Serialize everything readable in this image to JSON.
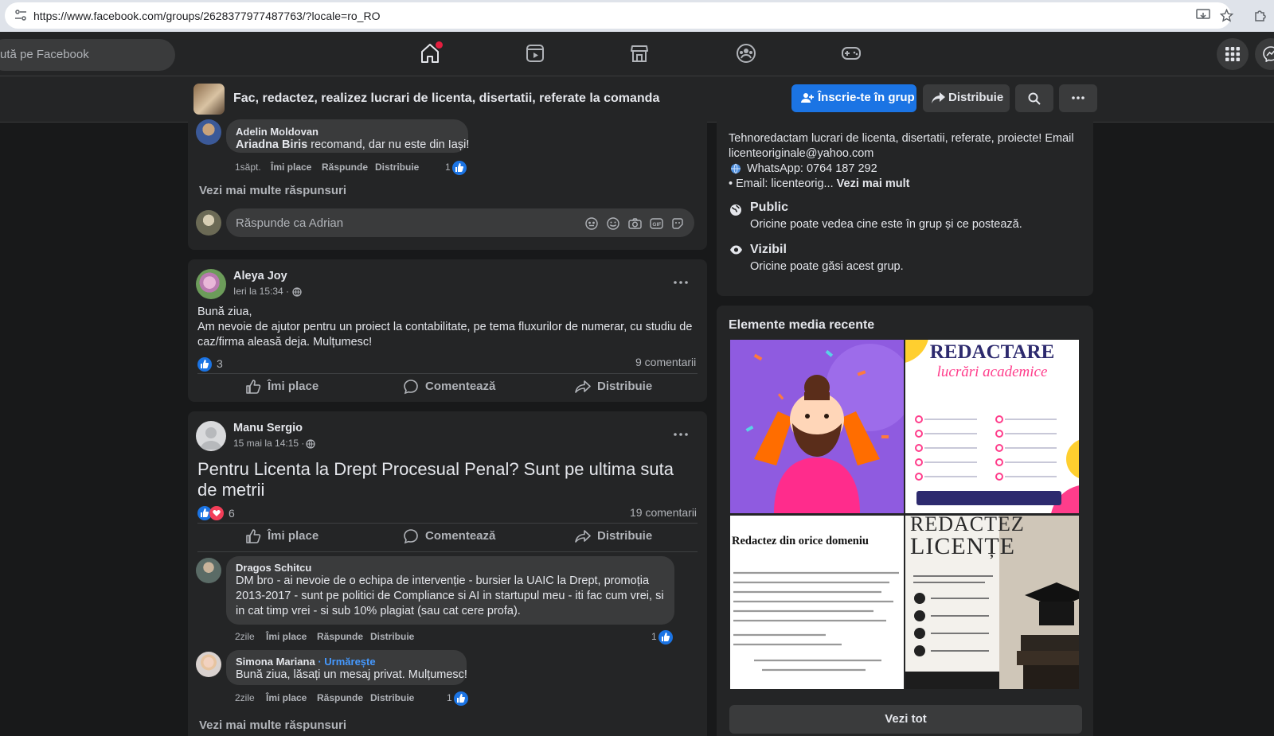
{
  "browser": {
    "url": "https://www.facebook.com/groups/2628377977487763/?locale=ro_RO"
  },
  "nav": {
    "search_placeholder": "ută pe Facebook",
    "icons": [
      "home-icon",
      "video-icon",
      "marketplace-icon",
      "groups-icon",
      "gaming-icon",
      "menu-grid-icon",
      "messenger-icon"
    ],
    "notification_color": "#e41e3f"
  },
  "group": {
    "title": "Fac, redactez, realizez lucrari de licenta, disertatii, referate la comanda",
    "join_label": "Înscrie-te în grup",
    "share_label": "Distribuie",
    "accent": "#1b74e4"
  },
  "comment_top": {
    "author": "Adelin Moldovan",
    "mention": "Ariadna Biris",
    "text": " recomand, dar nu este din Iași!",
    "time": "1săpt.",
    "like": "Îmi place",
    "reply": "Răspunde",
    "share": "Distribuie",
    "reactions": "1"
  },
  "more_replies_1": "Vezi mai multe răspunsuri",
  "reply_box": {
    "placeholder": "Răspunde ca Adrian",
    "icons": [
      "avatar-sticker-icon",
      "emoji-icon",
      "camera-icon",
      "gif-icon",
      "sticker-icon"
    ]
  },
  "post1": {
    "author": "Aleya Joy",
    "time": "Ieri la 15:34 ·",
    "text_lines": [
      "Bună ziua,",
      "Am nevoie de ajutor pentru un proiect la contabilitate, pe tema fluxurilor de numerar, cu studiu de",
      "caz/firma aleasă deja. Mulțumesc!"
    ],
    "reactions": "3",
    "comments": "9 comentarii",
    "like": "Îmi place",
    "comment": "Comentează",
    "share": "Distribuie"
  },
  "post2": {
    "author": "Manu Sergio",
    "time": "15 mai la 14:15 ·",
    "title_lines": [
      "Pentru Licenta la Drept Procesual Penal? Sunt pe ultima suta",
      "de metrii"
    ],
    "reactions": "6",
    "comments": "19 comentarii",
    "like": "Îmi place",
    "comment": "Comentează",
    "share": "Distribuie",
    "comments_list": [
      {
        "author": "Dragos Schitcu",
        "lines": [
          "DM bro - ai nevoie de o echipa de intervenție - bursier la UAIC la Drept, promoția",
          "2013-2017 - sunt pe politici de Compliance si AI in startupul meu - iti fac cum vrei, si",
          "in cat timp vrei - si sub 10% plagiat (sau cat cere profa)."
        ],
        "time": "2zile",
        "like": "Îmi place",
        "reply": "Răspunde",
        "share": "Distribuie",
        "reactions": "1"
      },
      {
        "author": "Simona Mariana",
        "follow": "· Urmărește",
        "lines": [
          "Bună ziua, lăsați un mesaj privat. Mulțumesc!"
        ],
        "time": "2zile",
        "like": "Îmi place",
        "reply": "Răspunde",
        "share": "Distribuie",
        "reactions": "1"
      }
    ],
    "more_replies": "Vezi mai multe răspunsuri"
  },
  "about": {
    "desc_lines": [
      "Tehnoredactam lucrari de licenta, disertatii, referate, proiecte! Email",
      "licenteoriginale@yahoo.com"
    ],
    "whatsapp": "WhatsApp: 0764 187 292",
    "email_line": "• Email: licenteorig...",
    "see_more": "Vezi mai mult",
    "public_title": "Public",
    "public_desc": "Oricine poate vedea cine este în grup și ce postează.",
    "visible_title": "Vizibil",
    "visible_desc": "Oricine poate găsi acest grup."
  },
  "media": {
    "title": "Elemente media recente",
    "tile2_title": "REDACTARE",
    "tile2_sub": "lucrări academice",
    "tile3_title": "Redactez din orice domeniu",
    "tile4_title_1": "REDACTEZ",
    "tile4_title_2": "LICENȚE",
    "see_all": "Vezi tot"
  }
}
